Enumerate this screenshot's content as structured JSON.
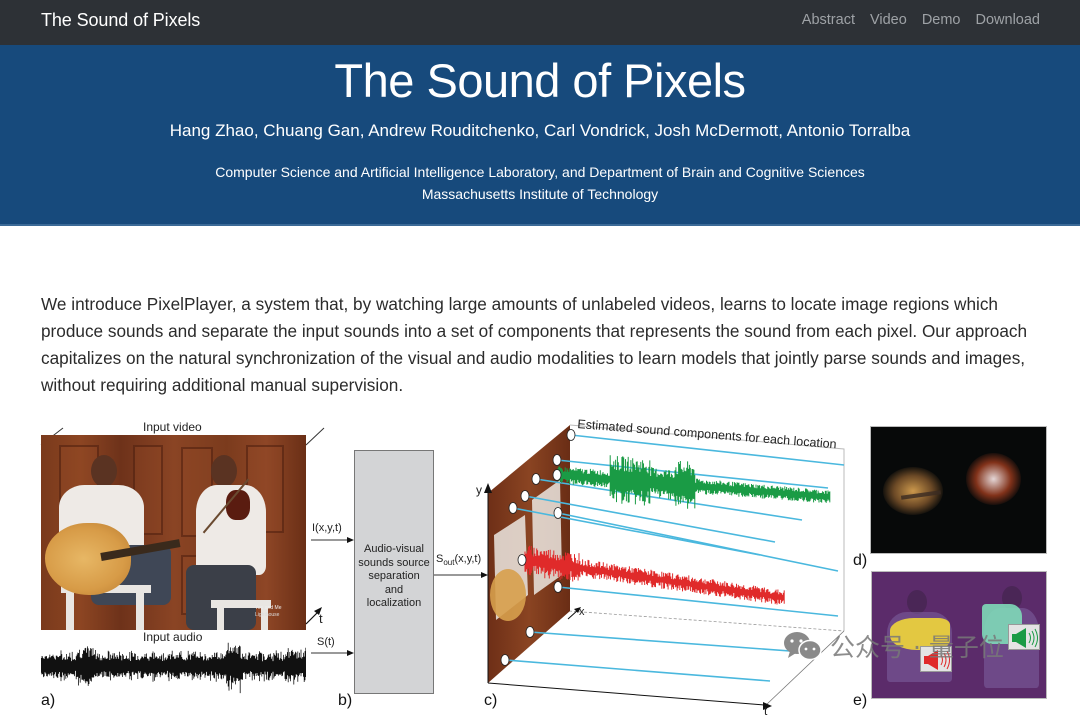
{
  "navbar": {
    "brand": "The Sound of Pixels",
    "links": [
      "Abstract",
      "Video",
      "Demo",
      "Download"
    ]
  },
  "hero": {
    "title": "The Sound of Pixels",
    "authors": "Hang Zhao, Chuang Gan, Andrew Rouditchenko, Carl Vondrick, Josh McDermott, Antonio Torralba",
    "affiliation_line1": "Computer Science and Artificial Intelligence Laboratory, and Department of Brain and Cognitive Sciences",
    "affiliation_line2": "Massachusetts Institute of Technology"
  },
  "abstract": {
    "text": "We introduce PixelPlayer, a system that, by watching large amounts of unlabeled videos, learns to locate image regions which produce sounds and separate the input sounds into a set of components that represents the sound from each pixel. Our approach capitalizes on the natural synchronization of the visual and audio modalities to learn models that jointly parse sounds and images, without requiring additional manual supervision."
  },
  "figure": {
    "panel_a": {
      "label": "a)",
      "input_video": "Input video",
      "input_audio": "Input audio",
      "t_axis": "t",
      "video_caption": "You and Me",
      "video_caption2": "Lighthouse"
    },
    "panel_b": {
      "label": "b)",
      "signal_image": "I(x,y,t)",
      "signal_audio": "S(t)",
      "block_text": [
        "Audio-visual",
        "sounds source",
        "separation",
        "and",
        "localization"
      ],
      "signal_out_main": "S",
      "signal_out_sub": "out",
      "signal_out_args": "(x,y,t)"
    },
    "panel_c": {
      "label": "c)",
      "title": "Estimated sound components for each location",
      "y_axis": "y",
      "x_axis": "x",
      "t_axis": "t"
    },
    "panel_d": {
      "label": "d)"
    },
    "panel_e": {
      "label": "e)"
    },
    "colors": {
      "blue_line": "#4ab8de",
      "green_wave": "#1a9b45",
      "red_wave": "#e02a2a",
      "yellow_mask": "#f0d838",
      "cyan_mask": "#7ed9b8"
    }
  },
  "watermark": {
    "text": "公众号 · 量子位"
  }
}
